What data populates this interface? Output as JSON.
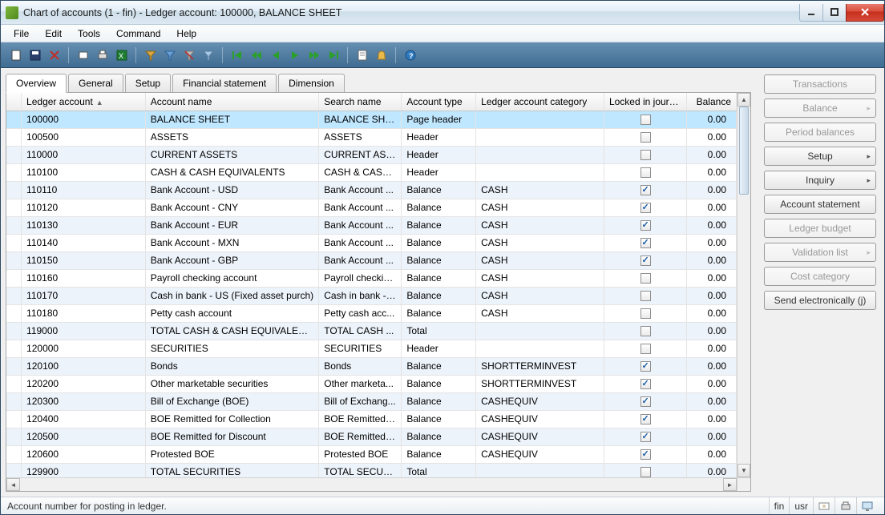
{
  "window": {
    "title": "Chart of accounts (1 - fin) - Ledger account: 100000, BALANCE SHEET"
  },
  "menu": {
    "file": "File",
    "edit": "Edit",
    "tools": "Tools",
    "command": "Command",
    "help": "Help"
  },
  "tabs": {
    "overview": "Overview",
    "general": "General",
    "setup": "Setup",
    "financial": "Financial statement",
    "dimension": "Dimension"
  },
  "columns": {
    "ledger": "Ledger account",
    "account": "Account name",
    "search": "Search name",
    "type": "Account type",
    "cat": "Ledger account category",
    "locked": "Locked in journal",
    "balance": "Balance"
  },
  "rows": [
    {
      "ledger": "100000",
      "account": "BALANCE SHEET",
      "search": "BALANCE SHEET",
      "type": "Page header",
      "cat": "",
      "locked": false,
      "balance": "0.00",
      "selected": true
    },
    {
      "ledger": "100500",
      "account": "ASSETS",
      "search": "ASSETS",
      "type": "Header",
      "cat": "",
      "locked": false,
      "balance": "0.00"
    },
    {
      "ledger": "110000",
      "account": "CURRENT ASSETS",
      "search": "CURRENT ASSE...",
      "type": "Header",
      "cat": "",
      "locked": false,
      "balance": "0.00"
    },
    {
      "ledger": "110100",
      "account": "CASH & CASH EQUIVALENTS",
      "search": "CASH & CASH ...",
      "type": "Header",
      "cat": "",
      "locked": false,
      "balance": "0.00"
    },
    {
      "ledger": "110110",
      "account": "Bank Account - USD",
      "search": "Bank Account ...",
      "type": "Balance",
      "cat": "CASH",
      "locked": true,
      "balance": "0.00"
    },
    {
      "ledger": "110120",
      "account": "Bank Account - CNY",
      "search": "Bank Account ...",
      "type": "Balance",
      "cat": "CASH",
      "locked": true,
      "balance": "0.00"
    },
    {
      "ledger": "110130",
      "account": "Bank Account - EUR",
      "search": "Bank Account ...",
      "type": "Balance",
      "cat": "CASH",
      "locked": true,
      "balance": "0.00"
    },
    {
      "ledger": "110140",
      "account": "Bank Account - MXN",
      "search": "Bank Account ...",
      "type": "Balance",
      "cat": "CASH",
      "locked": true,
      "balance": "0.00"
    },
    {
      "ledger": "110150",
      "account": "Bank Account - GBP",
      "search": "Bank Account ...",
      "type": "Balance",
      "cat": "CASH",
      "locked": true,
      "balance": "0.00"
    },
    {
      "ledger": "110160",
      "account": "Payroll checking account",
      "search": "Payroll checkin...",
      "type": "Balance",
      "cat": "CASH",
      "locked": false,
      "balance": "0.00"
    },
    {
      "ledger": "110170",
      "account": "Cash in bank - US (Fixed asset purch)",
      "search": "Cash in bank - ...",
      "type": "Balance",
      "cat": "CASH",
      "locked": false,
      "balance": "0.00"
    },
    {
      "ledger": "110180",
      "account": "Petty cash account",
      "search": "Petty cash acc...",
      "type": "Balance",
      "cat": "CASH",
      "locked": false,
      "balance": "0.00"
    },
    {
      "ledger": "119000",
      "account": "TOTAL CASH & CASH EQUIVALENTS",
      "search": "TOTAL CASH ...",
      "type": "Total",
      "cat": "",
      "locked": false,
      "balance": "0.00"
    },
    {
      "ledger": "120000",
      "account": "SECURITIES",
      "search": "SECURITIES",
      "type": "Header",
      "cat": "",
      "locked": false,
      "balance": "0.00"
    },
    {
      "ledger": "120100",
      "account": "Bonds",
      "search": "Bonds",
      "type": "Balance",
      "cat": "SHORTTERMINVEST",
      "locked": true,
      "balance": "0.00"
    },
    {
      "ledger": "120200",
      "account": "Other marketable securities",
      "search": "Other marketa...",
      "type": "Balance",
      "cat": "SHORTTERMINVEST",
      "locked": true,
      "balance": "0.00"
    },
    {
      "ledger": "120300",
      "account": "Bill of Exchange (BOE)",
      "search": "Bill of Exchang...",
      "type": "Balance",
      "cat": "CASHEQUIV",
      "locked": true,
      "balance": "0.00"
    },
    {
      "ledger": "120400",
      "account": "BOE Remitted for Collection",
      "search": "BOE Remitted f...",
      "type": "Balance",
      "cat": "CASHEQUIV",
      "locked": true,
      "balance": "0.00"
    },
    {
      "ledger": "120500",
      "account": "BOE Remitted for Discount",
      "search": "BOE Remitted f...",
      "type": "Balance",
      "cat": "CASHEQUIV",
      "locked": true,
      "balance": "0.00"
    },
    {
      "ledger": "120600",
      "account": "Protested BOE",
      "search": "Protested BOE",
      "type": "Balance",
      "cat": "CASHEQUIV",
      "locked": true,
      "balance": "0.00"
    },
    {
      "ledger": "129900",
      "account": "TOTAL SECURITIES",
      "search": "TOTAL SECURI...",
      "type": "Total",
      "cat": "",
      "locked": false,
      "balance": "0.00"
    }
  ],
  "side": {
    "transactions": "Transactions",
    "balance": "Balance",
    "period": "Period balances",
    "setup": "Setup",
    "inquiry": "Inquiry",
    "stmt": "Account statement",
    "budget": "Ledger budget",
    "validation": "Validation list",
    "costcat": "Cost category",
    "send": "Send electronically (j)"
  },
  "status": {
    "msg": "Account number for posting in ledger.",
    "fin": "fin",
    "usr": "usr"
  }
}
